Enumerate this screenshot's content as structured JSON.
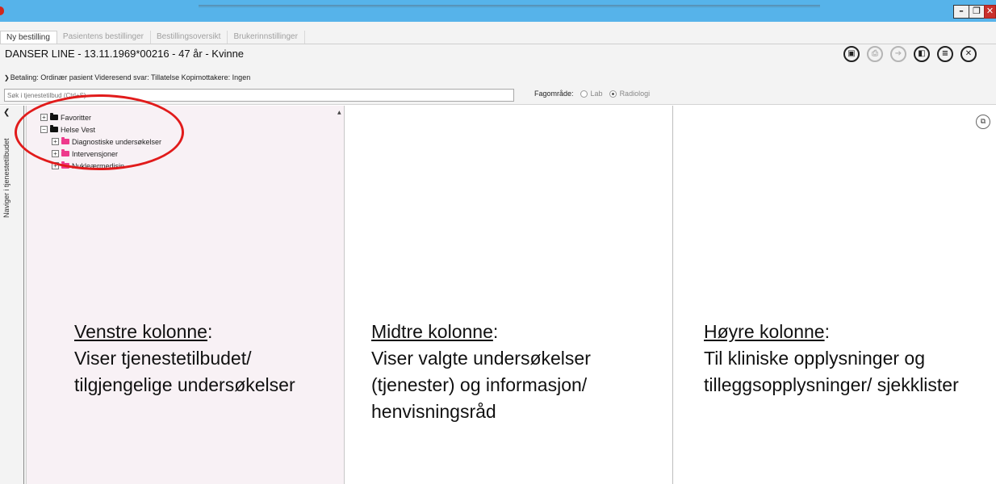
{
  "window": {
    "minimize": "–",
    "maximize": "❐",
    "close": "✕"
  },
  "tabs": [
    {
      "label": "Ny bestilling",
      "active": true
    },
    {
      "label": "Pasientens bestillinger",
      "active": false
    },
    {
      "label": "Bestillingsoversikt",
      "active": false
    },
    {
      "label": "Brukerinnstillinger",
      "active": false
    }
  ],
  "patient": {
    "header": "DANSER LINE - 13.11.1969*00216 - 47 år - Kvinne"
  },
  "toolbar": {
    "icons": [
      "save-icon",
      "print-icon",
      "send-icon",
      "book-icon",
      "list-icon",
      "close-icon"
    ]
  },
  "betaling": {
    "text": "Betaling: Ordinær pasient Videresend svar: Tillatelse Kopimottakere: Ingen"
  },
  "search": {
    "placeholder": "Søk i tjenestetilbud (Ctrl+S)"
  },
  "fagomrade": {
    "label": "Fagområde:",
    "options": [
      {
        "label": "Lab",
        "selected": false
      },
      {
        "label": "Radiologi",
        "selected": true
      }
    ]
  },
  "sidebar": {
    "vertical_label": "Naviger i tjenestetilbudet"
  },
  "tree": [
    {
      "label": "Favoritter",
      "level": 1,
      "expanded": false,
      "folder_color": "#111111"
    },
    {
      "label": "Helse Vest",
      "level": 1,
      "expanded": true,
      "folder_color": "#111111"
    },
    {
      "label": "Diagnostiske undersøkelser",
      "level": 2,
      "expanded": false,
      "folder_color": "#ee3a8c"
    },
    {
      "label": "Intervensjoner",
      "level": 2,
      "expanded": false,
      "folder_color": "#ee3a8c"
    },
    {
      "label": "Nukleærmedisin",
      "level": 2,
      "expanded": false,
      "folder_color": "#ee3a8c"
    }
  ],
  "captions": {
    "left": {
      "head": "Venstre kolonne",
      "colon": ":",
      "body": "Viser tjenestetilbudet/ tilgjengelige undersøkelser"
    },
    "middle": {
      "head": "Midtre kolonne",
      "colon": ":",
      "body": "Viser valgte undersøkelser (tjenester) og informasjon/ henvisningsråd"
    },
    "right": {
      "head": "Høyre kolonne",
      "colon": ":",
      "body": "Til kliniske opplysninger og tilleggsopplysninger/ sjekklister"
    }
  },
  "colors": {
    "titlebar": "#56b3ea",
    "left_panel": "#f8f1f5",
    "annotation": "#e11b1b",
    "folder_pink": "#ee3a8c"
  }
}
